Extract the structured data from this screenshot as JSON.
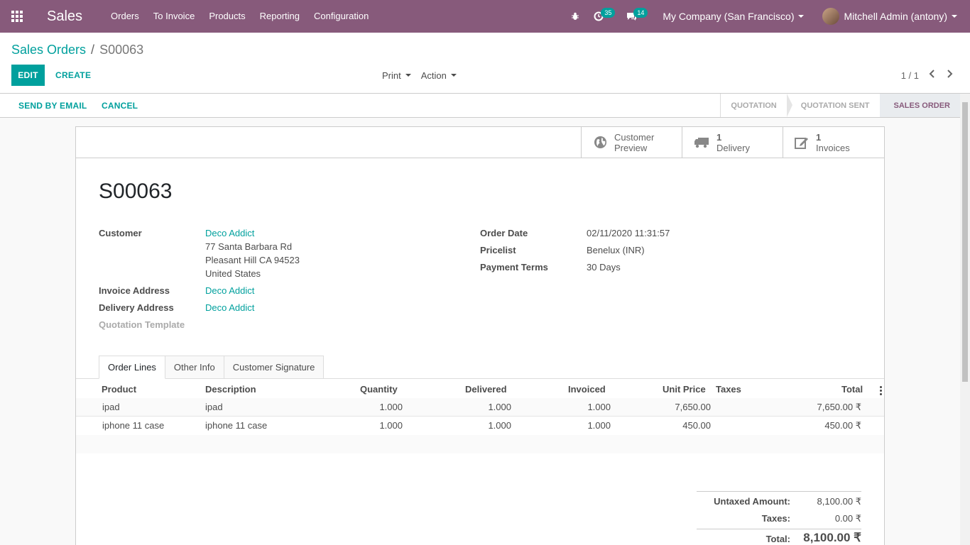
{
  "navbar": {
    "app_name": "Sales",
    "menu": [
      "Orders",
      "To Invoice",
      "Products",
      "Reporting",
      "Configuration"
    ],
    "activity_count": "35",
    "message_count": "14",
    "company": "My Company (San Francisco)",
    "user": "Mitchell Admin (antony)"
  },
  "control": {
    "breadcrumb_parent": "Sales Orders",
    "breadcrumb_sep": "/",
    "breadcrumb_current": "S00063",
    "edit_label": "EDIT",
    "create_label": "CREATE",
    "print_label": "Print",
    "action_label": "Action",
    "pager": "1 / 1"
  },
  "statusbar": {
    "send_email": "SEND BY EMAIL",
    "cancel": "CANCEL",
    "stages": [
      "QUOTATION",
      "QUOTATION SENT",
      "SALES ORDER"
    ],
    "active_stage": "SALES ORDER"
  },
  "smart_buttons": {
    "preview_line1": "Customer",
    "preview_line2": "Preview",
    "delivery_count": "1",
    "delivery_label": "Delivery",
    "invoice_count": "1",
    "invoice_label": "Invoices"
  },
  "form": {
    "name": "S00063",
    "customer_label": "Customer",
    "customer_name": "Deco Addict",
    "address_line1": "77 Santa Barbara Rd",
    "address_line2": "Pleasant Hill CA 94523",
    "address_line3": "United States",
    "invoice_address_label": "Invoice Address",
    "invoice_address": "Deco Addict",
    "delivery_address_label": "Delivery Address",
    "delivery_address": "Deco Addict",
    "quotation_template_label": "Quotation Template",
    "order_date_label": "Order Date",
    "order_date": "02/11/2020 11:31:57",
    "pricelist_label": "Pricelist",
    "pricelist": "Benelux (INR)",
    "payment_terms_label": "Payment Terms",
    "payment_terms": "30 Days"
  },
  "tabs": [
    "Order Lines",
    "Other Info",
    "Customer Signature"
  ],
  "order_lines": {
    "headers": [
      "Product",
      "Description",
      "Quantity",
      "Delivered",
      "Invoiced",
      "Unit Price",
      "Taxes",
      "Total"
    ],
    "rows": [
      {
        "product": "ipad",
        "description": "ipad",
        "quantity": "1.000",
        "delivered": "1.000",
        "invoiced": "1.000",
        "unit_price": "7,650.00",
        "taxes": "",
        "total": "7,650.00 ₹"
      },
      {
        "product": "iphone 11 case",
        "description": "iphone 11 case",
        "quantity": "1.000",
        "delivered": "1.000",
        "invoiced": "1.000",
        "unit_price": "450.00",
        "taxes": "",
        "total": "450.00 ₹"
      }
    ]
  },
  "totals": {
    "untaxed_label": "Untaxed Amount:",
    "untaxed_value": "8,100.00 ₹",
    "taxes_label": "Taxes:",
    "taxes_value": "0.00 ₹",
    "total_label": "Total:",
    "total_value": "8,100.00 ₹"
  },
  "colors": {
    "navbar": "#875a7b",
    "accent": "#00a09d"
  }
}
